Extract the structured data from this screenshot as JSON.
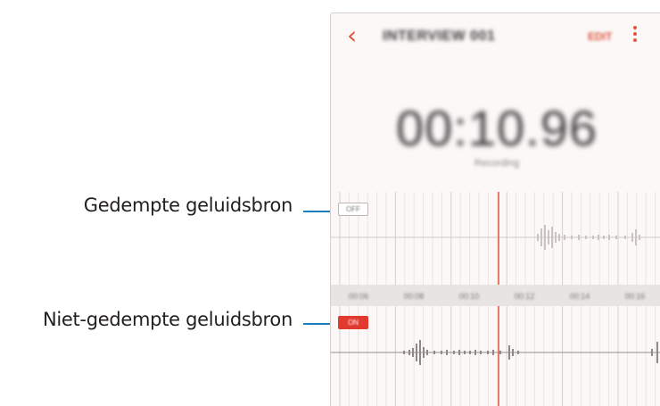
{
  "callouts": {
    "muted": "Gedempte geluidsbron",
    "unmuted": "Niet-gedempte geluidsbron"
  },
  "app": {
    "back_icon": "chevron-left-icon",
    "title": "INTERVIEW 001",
    "edit_label": "EDIT",
    "more_icon": "more-vert-icon",
    "elapsed_time": "00:10.96",
    "status_text": "Recording",
    "muted_tag": "OFF",
    "unmuted_tag": "ON",
    "timeline_ticks": [
      "00:06",
      "00:08",
      "00:10",
      "00:12",
      "00:14",
      "00:16"
    ]
  },
  "colors": {
    "accent": "#e0573f",
    "playhead": "#e0573f",
    "callout_line": "#1a7fc1",
    "unmuted_tag": "#e2392f"
  }
}
